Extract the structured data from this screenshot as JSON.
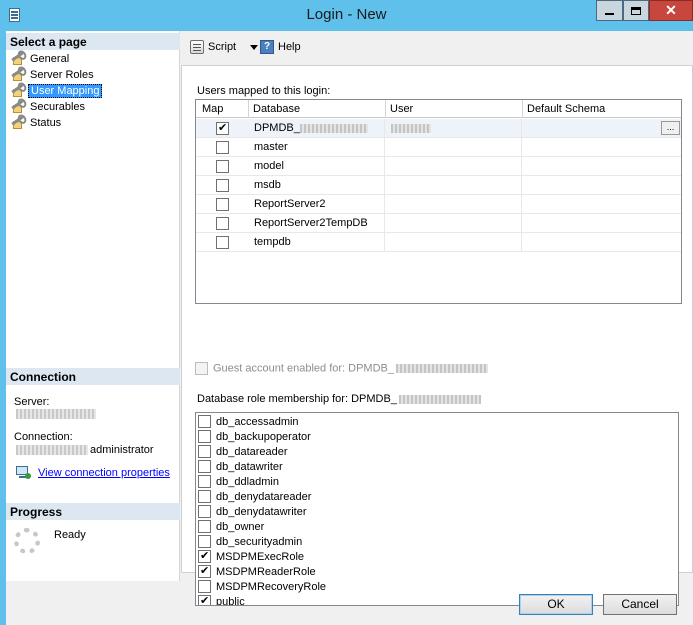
{
  "window": {
    "title": "Login - New",
    "minimize": "",
    "maximize": "",
    "close": "✕"
  },
  "left": {
    "select_page_header": "Select a page",
    "pages": [
      {
        "label": "General",
        "selected": false
      },
      {
        "label": "Server Roles",
        "selected": false
      },
      {
        "label": "User Mapping",
        "selected": true
      },
      {
        "label": "Securables",
        "selected": false
      },
      {
        "label": "Status",
        "selected": false
      }
    ],
    "connection_header": "Connection",
    "server_label": "Server:",
    "connection_label": "Connection:",
    "connection_user": "administrator",
    "view_props_link": "View connection properties",
    "progress_header": "Progress",
    "progress_status": "Ready"
  },
  "toolbar": {
    "script_label": "Script",
    "help_label": "Help"
  },
  "main": {
    "users_mapped_label": "Users mapped to this login:",
    "columns": [
      "Map",
      "Database",
      "User",
      "Default Schema"
    ],
    "rows": [
      {
        "checked": true,
        "database": "DPMDB_",
        "user": "",
        "schema": ""
      },
      {
        "checked": false,
        "database": "master",
        "user": "",
        "schema": ""
      },
      {
        "checked": false,
        "database": "model",
        "user": "",
        "schema": ""
      },
      {
        "checked": false,
        "database": "msdb",
        "user": "",
        "schema": ""
      },
      {
        "checked": false,
        "database": "ReportServer2",
        "user": "",
        "schema": ""
      },
      {
        "checked": false,
        "database": "ReportServer2TempDB",
        "user": "",
        "schema": ""
      },
      {
        "checked": false,
        "database": "tempdb",
        "user": "",
        "schema": ""
      }
    ],
    "ellipsis": "...",
    "guest_label": "Guest account enabled for: DPMDB_",
    "role_membership_label": "Database role membership for: DPMDB_",
    "roles": [
      {
        "name": "db_accessadmin",
        "checked": false
      },
      {
        "name": "db_backupoperator",
        "checked": false
      },
      {
        "name": "db_datareader",
        "checked": false
      },
      {
        "name": "db_datawriter",
        "checked": false
      },
      {
        "name": "db_ddladmin",
        "checked": false
      },
      {
        "name": "db_denydatareader",
        "checked": false
      },
      {
        "name": "db_denydatawriter",
        "checked": false
      },
      {
        "name": "db_owner",
        "checked": false
      },
      {
        "name": "db_securityadmin",
        "checked": false
      },
      {
        "name": "MSDPMExecRole",
        "checked": true
      },
      {
        "name": "MSDPMReaderRole",
        "checked": true
      },
      {
        "name": "MSDPMRecoveryRole",
        "checked": false
      },
      {
        "name": "public",
        "checked": true
      }
    ]
  },
  "buttons": {
    "ok": "OK",
    "cancel": "Cancel"
  }
}
